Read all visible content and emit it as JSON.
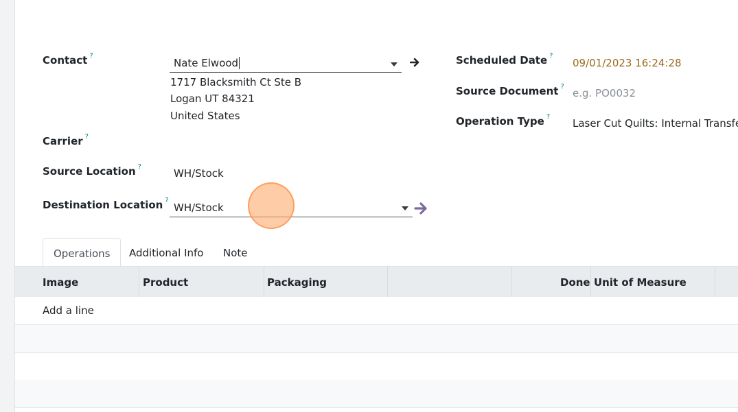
{
  "form": {
    "contact": {
      "label": "Contact",
      "help": "?",
      "value": "Nate Elwood"
    },
    "address": [
      "1717 Blacksmith Ct Ste B",
      "Logan UT 84321",
      "United States"
    ],
    "carrier": {
      "label": "Carrier",
      "help": "?"
    },
    "source_location": {
      "label": "Source Location",
      "help": "?",
      "value": "WH/Stock"
    },
    "destination_location": {
      "label": "Destination Location",
      "help": "?",
      "value": "WH/Stock"
    },
    "scheduled_date": {
      "label": "Scheduled Date",
      "help": "?",
      "value": "09/01/2023 16:24:28",
      "color": "#9a6b1e"
    },
    "source_document": {
      "label": "Source Document",
      "help": "?",
      "placeholder": "e.g. PO0032"
    },
    "operation_type": {
      "label": "Operation Type",
      "help": "?",
      "value": "Laser Cut Quilts: Internal Transfers"
    }
  },
  "tabs": [
    "Operations",
    "Additional Info",
    "Note"
  ],
  "table": {
    "columns": [
      "Image",
      "Product",
      "Packaging",
      "",
      "Done",
      "Unit of Measure"
    ],
    "add_line": "Add a line"
  },
  "icons": {
    "contact_open": "arrow-right-icon",
    "destination_open": "arrow-right-icon",
    "dropdown": "chevron-down-icon"
  },
  "colors": {
    "accent": "#714b67",
    "help": "#017e84",
    "date": "#9a6b1e"
  }
}
